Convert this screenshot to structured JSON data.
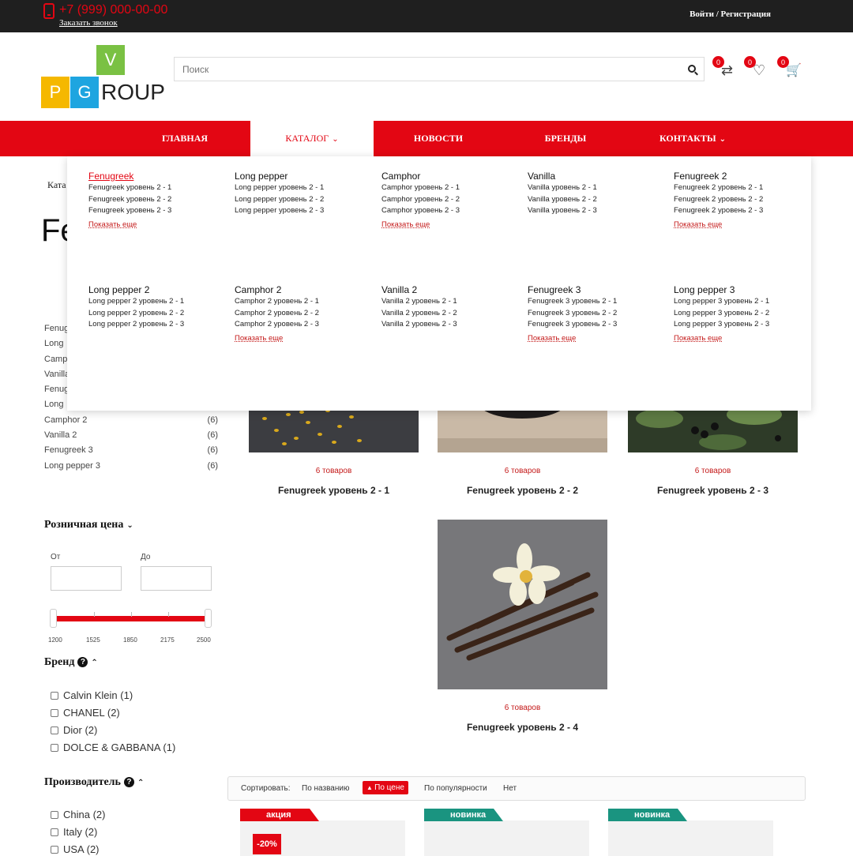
{
  "topbar": {
    "phone": "+7 (999) 000-00-00",
    "callback": "Заказать звонок",
    "login": "Войти / Регистрация"
  },
  "logo": {
    "v": "V",
    "p": "P",
    "g": "G",
    "roup": "ROUP"
  },
  "search": {
    "placeholder": "Поиск"
  },
  "header_icons": {
    "compare_count": "0",
    "favorites_count": "0",
    "cart_count": "0"
  },
  "nav": {
    "items": [
      "ГЛАВНАЯ",
      "КАТАЛОГ",
      "НОВОСТИ",
      "БРЕНДЫ",
      "КОНТАКТЫ"
    ],
    "active": "КАТАЛОГ"
  },
  "breadcrumb": "Ката",
  "page_title": "Fe",
  "sidebar": {
    "categories": [
      {
        "name": "Fenug",
        "count": ""
      },
      {
        "name": "Long",
        "count": ""
      },
      {
        "name": "Campt",
        "count": ""
      },
      {
        "name": "Vanilla",
        "count": ""
      },
      {
        "name": "Fenug",
        "count": ""
      },
      {
        "name": "Long",
        "count": ""
      },
      {
        "name": "Camphor 2",
        "count": "(6)"
      },
      {
        "name": "Vanilla 2",
        "count": "(6)"
      },
      {
        "name": "Fenugreek 3",
        "count": "(6)"
      },
      {
        "name": "Long pepper 3",
        "count": "(6)"
      }
    ],
    "price": {
      "title": "Розничная цена",
      "from_label": "От",
      "to_label": "До",
      "ticks": [
        "1200",
        "1525",
        "1850",
        "2175",
        "2500"
      ]
    },
    "brand": {
      "title": "Бренд",
      "items": [
        "Calvin Klein (1)",
        "CHANEL (2)",
        "Dior (2)",
        "DOLCE & GABBANA (1)"
      ]
    },
    "manufacturer": {
      "title": "Производитель",
      "items": [
        "China (2)",
        "Italy (2)",
        "USA (2)"
      ]
    }
  },
  "subcategories": [
    {
      "count": "6 товаров",
      "name": "Fenugreek уровень 2 - 1"
    },
    {
      "count": "6 товаров",
      "name": "Fenugreek уровень 2 - 2"
    },
    {
      "count": "6 товаров",
      "name": "Fenugreek уровень 2 - 3"
    },
    {
      "count": "6 товаров",
      "name": "Fenugreek уровень 2 - 4"
    }
  ],
  "sort": {
    "label": "Сортировать:",
    "options": [
      "По названию",
      "По цене",
      "По популярности",
      "Нет"
    ],
    "active": "По цене"
  },
  "products": [
    {
      "ribbon": "акция",
      "ribbon_color": "#e30613",
      "sale": "-20%"
    },
    {
      "ribbon": "новинка",
      "ribbon_color": "#1a9480",
      "sale": ""
    },
    {
      "ribbon": "новинка",
      "ribbon_color": "#1a9480",
      "sale": ""
    }
  ],
  "megamenu": {
    "more_label": "Показать еще",
    "columns": [
      {
        "title": "Fenugreek",
        "items": [
          "Fenugreek уровень 2 - 1",
          "Fenugreek уровень 2 - 2",
          "Fenugreek уровень 2 - 3"
        ]
      },
      {
        "title": "Long pepper",
        "items": [
          "Long pepper уровень 2 - 1",
          "Long pepper уровень 2 - 2",
          "Long pepper уровень 2 - 3"
        ]
      },
      {
        "title": "Camphor",
        "items": [
          "Camphor уровень 2 - 1",
          "Camphor уровень 2 - 2",
          "Camphor уровень 2 - 3"
        ]
      },
      {
        "title": "Vanilla",
        "items": [
          "Vanilla уровень 2 - 1",
          "Vanilla уровень 2 - 2",
          "Vanilla уровень 2 - 3"
        ]
      },
      {
        "title": "Fenugreek 2",
        "items": [
          "Fenugreek 2 уровень 2 - 1",
          "Fenugreek 2 уровень 2 - 2",
          "Fenugreek 2 уровень 2 - 3"
        ]
      },
      {
        "title": "Long pepper 2",
        "items": [
          "Long pepper 2 уровень 2 - 1",
          "Long pepper 2 уровень 2 - 2",
          "Long pepper 2 уровень 2 - 3"
        ]
      },
      {
        "title": "Camphor 2",
        "items": [
          "Camphor 2 уровень 2 - 1",
          "Camphor 2 уровень 2 - 2",
          "Camphor 2 уровень 2 - 3"
        ]
      },
      {
        "title": "Vanilla 2",
        "items": [
          "Vanilla 2 уровень 2 - 1",
          "Vanilla 2 уровень 2 - 2",
          "Vanilla 2 уровень 2 - 3"
        ]
      },
      {
        "title": "Fenugreek 3",
        "items": [
          "Fenugreek 3 уровень 2 - 1",
          "Fenugreek 3 уровень 2 - 2",
          "Fenugreek 3 уровень 2 - 3"
        ]
      },
      {
        "title": "Long pepper 3",
        "items": [
          "Long pepper 3 уровень 2 - 1",
          "Long pepper 3 уровень 2 - 2",
          "Long pepper 3 уровень 2 - 3"
        ]
      }
    ]
  },
  "colors": {
    "accent": "#e30613",
    "dark": "#1f1f1f",
    "logo_green": "#7ac143",
    "logo_yellow": "#f5b800",
    "logo_blue": "#1ea5e0"
  }
}
